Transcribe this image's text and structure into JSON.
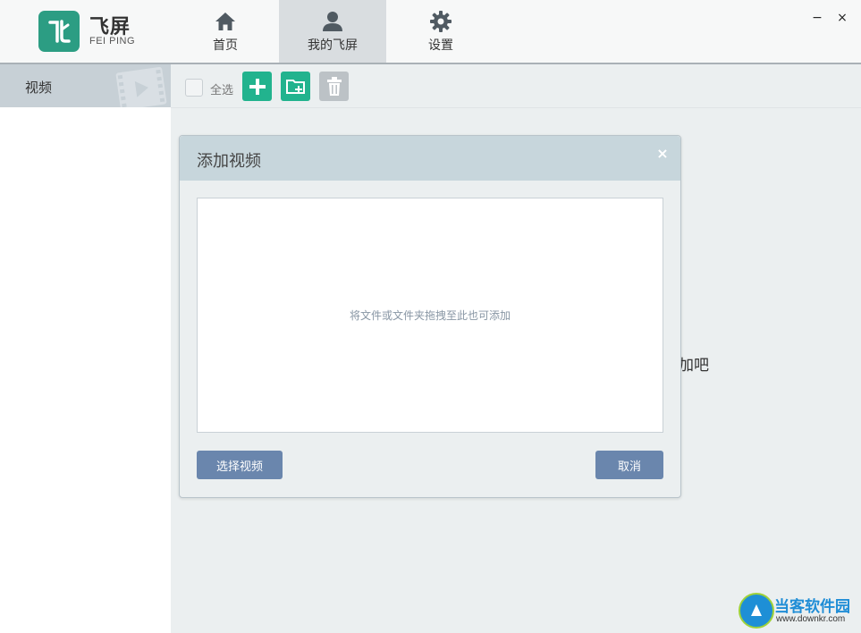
{
  "app": {
    "logo_title": "飞屏",
    "logo_subtitle": "FEI PING",
    "brand_color": "#2c9d83"
  },
  "nav": {
    "tabs": [
      {
        "label": "首页",
        "icon": "home-icon",
        "active": false
      },
      {
        "label": "我的飞屏",
        "icon": "user-icon",
        "active": true
      },
      {
        "label": "设置",
        "icon": "gear-icon",
        "active": false
      }
    ]
  },
  "window": {
    "minimize": "−",
    "close": "×"
  },
  "sidebar": {
    "items": [
      {
        "label": "视频",
        "icon": "film-play-icon",
        "selected": true
      }
    ]
  },
  "toolbar": {
    "select_all_label": "全选",
    "add_icon": "plus-icon",
    "add_folder_icon": "folder-add-icon",
    "delete_icon": "trash-icon",
    "accent": "#22b38e"
  },
  "background": {
    "hint_fragment": "加吧"
  },
  "dialog": {
    "title": "添加视频",
    "close": "×",
    "drop_hint": "将文件或文件夹拖拽至此也可添加",
    "select_button": "选择视频",
    "cancel_button": "取消",
    "button_color": "#6a86ad"
  },
  "watermark": {
    "title": "当客软件园",
    "url": "www.downkr.com"
  }
}
